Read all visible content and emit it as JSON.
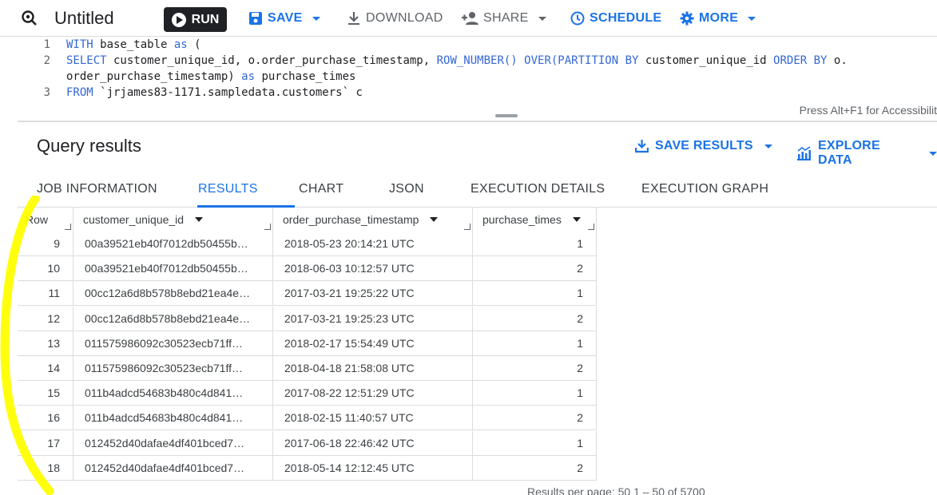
{
  "toolbar": {
    "title": "Untitled",
    "run_label": "RUN",
    "save_label": "SAVE",
    "download_label": "DOWNLOAD",
    "share_label": "SHARE",
    "schedule_label": "SCHEDULE",
    "more_label": "MORE"
  },
  "editor": {
    "lines": [
      {
        "n": "1",
        "parts": [
          [
            "kw",
            "WITH"
          ],
          [
            "t",
            " base_table "
          ],
          [
            "kw",
            "as"
          ],
          [
            "t",
            " ("
          ]
        ]
      },
      {
        "n": "2",
        "parts": [
          [
            "kw",
            "SELECT"
          ],
          [
            "t",
            " customer_unique_id, o.order_purchase_timestamp, "
          ],
          [
            "kw",
            "ROW_NUMBER() OVER(PARTITION BY"
          ],
          [
            "t",
            " customer_unique_id "
          ],
          [
            "kw",
            "ORDER BY"
          ],
          [
            "t",
            " o."
          ]
        ]
      },
      {
        "n": "",
        "parts": [
          [
            "t",
            "order_purchase_timestamp) "
          ],
          [
            "kw",
            "as"
          ],
          [
            "t",
            " purchase_times"
          ]
        ]
      },
      {
        "n": "3",
        "parts": [
          [
            "kw",
            "FROM"
          ],
          [
            "t",
            " `jrjames83-1171.sampledata.customers` c"
          ]
        ]
      }
    ],
    "a11y_hint": "Press Alt+F1 for Accessibilit"
  },
  "results": {
    "title": "Query results",
    "save_results_label": "SAVE RESULTS",
    "explore_data_label": "EXPLORE DATA",
    "tabs": [
      "JOB INFORMATION",
      "RESULTS",
      "CHART",
      "JSON",
      "EXECUTION DETAILS",
      "EXECUTION GRAPH"
    ],
    "active_tab": "RESULTS",
    "columns": [
      "Row",
      "customer_unique_id",
      "order_purchase_timestamp",
      "purchase_times"
    ],
    "rows": [
      [
        "9",
        "00a39521eb40f7012db50455b…",
        "2018-05-23 20:14:21 UTC",
        "1"
      ],
      [
        "10",
        "00a39521eb40f7012db50455b…",
        "2018-06-03 10:12:57 UTC",
        "2"
      ],
      [
        "11",
        "00cc12a6d8b578b8ebd21ea4e…",
        "2017-03-21 19:25:22 UTC",
        "1"
      ],
      [
        "12",
        "00cc12a6d8b578b8ebd21ea4e…",
        "2017-03-21 19:25:23 UTC",
        "2"
      ],
      [
        "13",
        "011575986092c30523ecb71ff…",
        "2018-02-17 15:54:49 UTC",
        "1"
      ],
      [
        "14",
        "011575986092c30523ecb71ff…",
        "2018-04-18 21:58:08 UTC",
        "2"
      ],
      [
        "15",
        "011b4adcd54683b480c4d841…",
        "2017-08-22 12:51:29 UTC",
        "1"
      ],
      [
        "16",
        "011b4adcd54683b480c4d841…",
        "2018-02-15 11:40:57 UTC",
        "2"
      ],
      [
        "17",
        "012452d40dafae4df401bced7…",
        "2017-06-18 22:46:42 UTC",
        "1"
      ],
      [
        "18",
        "012452d40dafae4df401bced7…",
        "2018-05-14 12:12:45 UTC",
        "2"
      ]
    ],
    "pager_text": "Results per page:    50      1 – 50 of 5700"
  },
  "colors": {
    "accent": "#1a73e8",
    "run_button": "#202124",
    "highlight_marker": "#ffff00"
  }
}
